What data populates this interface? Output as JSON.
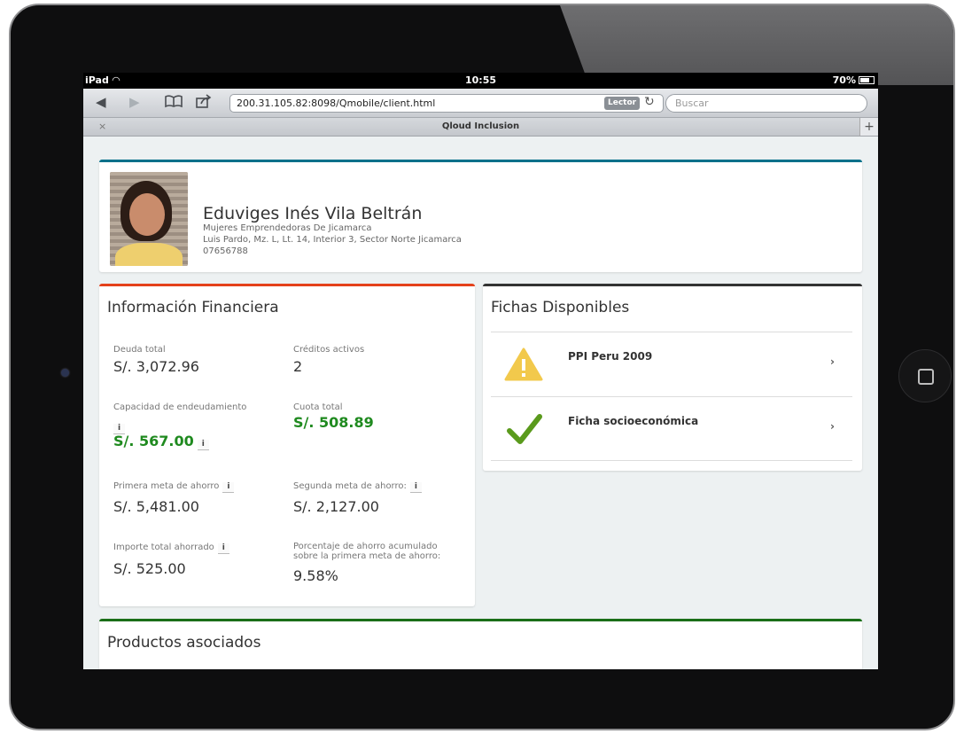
{
  "status_bar": {
    "device": "iPad",
    "time": "10:55",
    "battery": "70%"
  },
  "browser": {
    "url": "200.31.105.82:8098/Qmobile/client.html",
    "reader_label": "Lector",
    "search_placeholder": "Buscar",
    "tab_title": "Qloud Inclusion",
    "tab_close": "×",
    "tab_add": "+"
  },
  "profile": {
    "name": "Eduviges Inés Vila Beltrán",
    "group": "Mujeres Emprendedoras De Jicamarca",
    "address": "Luis Pardo, Mz. L, Lt. 14, Interior 3, Sector Norte Jicamarca",
    "id_number": "07656788"
  },
  "financial": {
    "title": "Información Financiera",
    "info_symbol": "i",
    "total_debt": {
      "label": "Deuda total",
      "value": "S/. 3,072.96"
    },
    "active_credits": {
      "label": "Créditos activos",
      "value": "2"
    },
    "debt_capacity": {
      "label": "Capacidad de endeudamiento",
      "value": "S/. 567.00"
    },
    "total_quota": {
      "label": "Cuota total",
      "value": "S/. 508.89"
    },
    "first_goal": {
      "label": "Primera meta de ahorro",
      "value": "S/. 5,481.00"
    },
    "second_goal": {
      "label": "Segunda meta de ahorro:",
      "value": "S/. 2,127.00"
    },
    "total_saved": {
      "label": "Importe total ahorrado",
      "value": "S/. 525.00"
    },
    "saving_pct": {
      "label": "Porcentaje de ahorro acumulado sobre la primera meta de ahorro:",
      "value": "9.58%"
    }
  },
  "fichas": {
    "title": "Fichas Disponibles",
    "items": [
      {
        "name": "PPI Peru 2009",
        "icon": "warning-icon",
        "icon_color": "#f2c94c"
      },
      {
        "name": "Ficha socioeconómica",
        "icon": "check-icon",
        "icon_color": "#5a9a1c"
      }
    ]
  },
  "products": {
    "title": "Productos asociados"
  },
  "colors": {
    "profile_accent": "#00708a",
    "financial_accent": "#e4411b",
    "fichas_accent": "#333333",
    "products_accent": "#1a6e18",
    "green_value": "#1f8a1f"
  }
}
